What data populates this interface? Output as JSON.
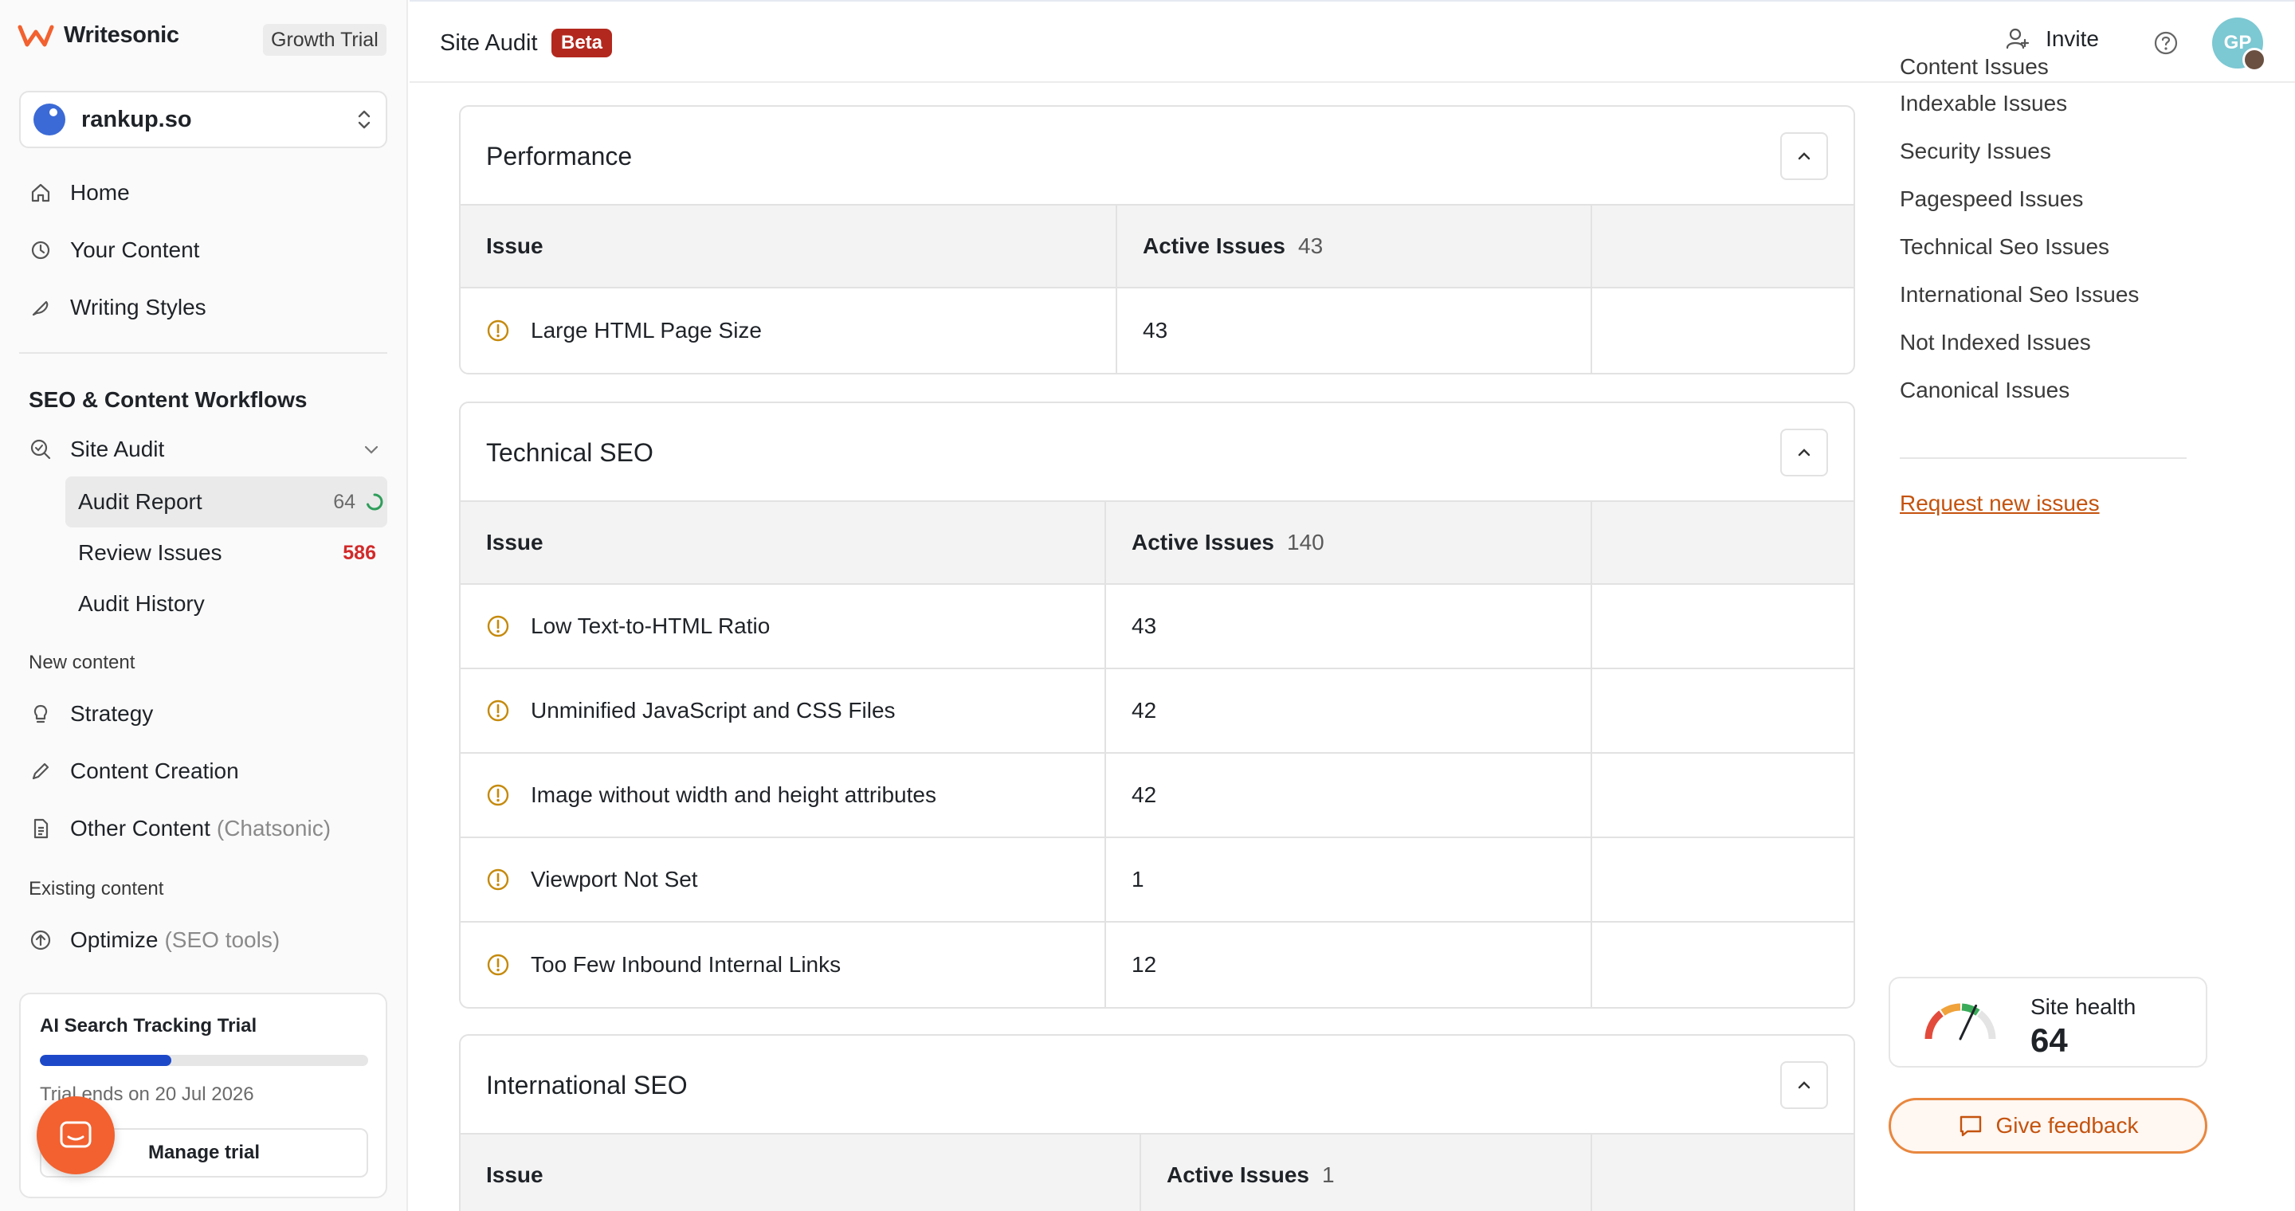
{
  "brand": {
    "name": "Writesonic",
    "plan": "Growth Trial"
  },
  "workspace": {
    "name": "rankup.so"
  },
  "nav_primary": [
    {
      "label": "Home",
      "icon": "home-icon"
    },
    {
      "label": "Your Content",
      "icon": "history-icon"
    },
    {
      "label": "Writing Styles",
      "icon": "feather-icon"
    }
  ],
  "seo_section": {
    "title": "SEO & Content Workflows",
    "site_audit": {
      "label": "Site Audit"
    },
    "sub_items": [
      {
        "label": "Audit Report",
        "count": "64"
      },
      {
        "label": "Review Issues",
        "count": "586"
      },
      {
        "label": "Audit History",
        "count": ""
      }
    ]
  },
  "new_content": {
    "label": "New content",
    "items": [
      {
        "label": "Strategy",
        "suffix": ""
      },
      {
        "label": "Content Creation",
        "suffix": ""
      },
      {
        "label": "Other Content",
        "suffix": "(Chatsonic)"
      }
    ]
  },
  "existing_content": {
    "label": "Existing content",
    "items": [
      {
        "label": "Optimize",
        "suffix": "(SEO tools)"
      }
    ]
  },
  "trial": {
    "title": "AI Search Tracking Trial",
    "progress": 0.4,
    "ends": "Trial ends on 20 Jul 2026",
    "button": "Manage trial"
  },
  "topbar": {
    "title": "Site Audit",
    "badge": "Beta",
    "invite": "Invite",
    "avatar_initials": "GP"
  },
  "panels": [
    {
      "title": "Performance",
      "col_issue": "Issue",
      "col_active": "Active Issues",
      "active_total": "43",
      "rows": [
        {
          "issue": "Large HTML Page Size",
          "count": "43"
        }
      ]
    },
    {
      "title": "Technical SEO",
      "col_issue": "Issue",
      "col_active": "Active Issues",
      "active_total": "140",
      "rows": [
        {
          "issue": "Low Text-to-HTML Ratio",
          "count": "43"
        },
        {
          "issue": "Unminified JavaScript and CSS Files",
          "count": "42"
        },
        {
          "issue": "Image without width and height attributes",
          "count": "42"
        },
        {
          "issue": "Viewport Not Set",
          "count": "1"
        },
        {
          "issue": "Too Few Inbound Internal Links",
          "count": "12"
        }
      ]
    },
    {
      "title": "International SEO",
      "col_issue": "Issue",
      "col_active": "Active Issues",
      "active_total": "1",
      "rows": []
    }
  ],
  "toc": {
    "items": [
      "Content Issues",
      "Indexable Issues",
      "Security Issues",
      "Pagespeed Issues",
      "Technical Seo Issues",
      "International Seo Issues",
      "Not Indexed Issues",
      "Canonical Issues"
    ],
    "request_link": "Request new issues"
  },
  "site_health": {
    "label": "Site health",
    "value": "64",
    "score": 64
  },
  "feedback": {
    "label": "Give feedback"
  },
  "colors": {
    "accent": "#f2612f",
    "badge": "#b3281e",
    "link": "#c4530e",
    "progress": "#1d49c9",
    "warning": "#c58a0d"
  }
}
